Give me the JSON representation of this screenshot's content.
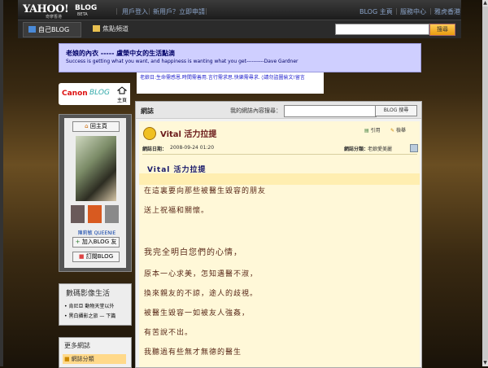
{
  "topbar": {
    "logo": "YAHOO!",
    "logo_sub": "奇摩香港",
    "blog": "BLOG",
    "beta": "BETA",
    "links_left": [
      "用戶登入",
      "新用戶？",
      "立即申請"
    ],
    "links_right": [
      "BLOG 主頁",
      "服務中心",
      "雅虎香港"
    ]
  },
  "nav": {
    "tabs": [
      "自己BLOG",
      "焦點頻道"
    ],
    "search_placeholder": "",
    "search_button": "搜尋"
  },
  "header": {
    "title": "老娘的內衣 ----- 盧榮中女的生活點滴",
    "subtitle": "Success is getting what you want, and happiness is wanting what you get----------Dave Gardner"
  },
  "description": "老娘日:生命需感恩.時間需善用.言行需求思.快樂需尋求. ◊請勿盜圖偷文!留言",
  "sidebar": {
    "canon": "Canon",
    "canon2": "BLOG",
    "home_label": "主頁",
    "back_home": "回主頁",
    "owner": "陳莉敏 QUEENIE",
    "add_friend": "加入BLOG 友",
    "subscribe": "訂閱BLOG",
    "section_title": "數碼影像生活",
    "links": [
      "肯尼亞 動物天堂以外",
      "黑白攝影之旅 — 下篇"
    ],
    "more_title": "更多網誌",
    "category": "網誌分類"
  },
  "main": {
    "title": "網誌",
    "search_label": "我的網誌內容搜尋：",
    "search_button": "BLOG 搜尋",
    "post": {
      "title": "Vital 活力拉提",
      "quote": "引用",
      "report": "檢舉",
      "date_label": "網誌日期：",
      "date": "2008-09-24 01:20",
      "cat_label": "網誌分類：",
      "cat": "老娘愛美麗",
      "body_title": "Vital 活力拉提",
      "paras": [
        "在這裏要向那些被醫生毀容的朋友",
        "送上祝福和關懷。",
        "我完全明白您們的心情，",
        "原本一心求美，怎知遇醫不淑，",
        "換來親友的不諒，途人的歧視。",
        "被醫生毀容一如被友人強姦，",
        "有苦說不出。",
        "我聽過有些無才無德的醫生"
      ]
    }
  }
}
